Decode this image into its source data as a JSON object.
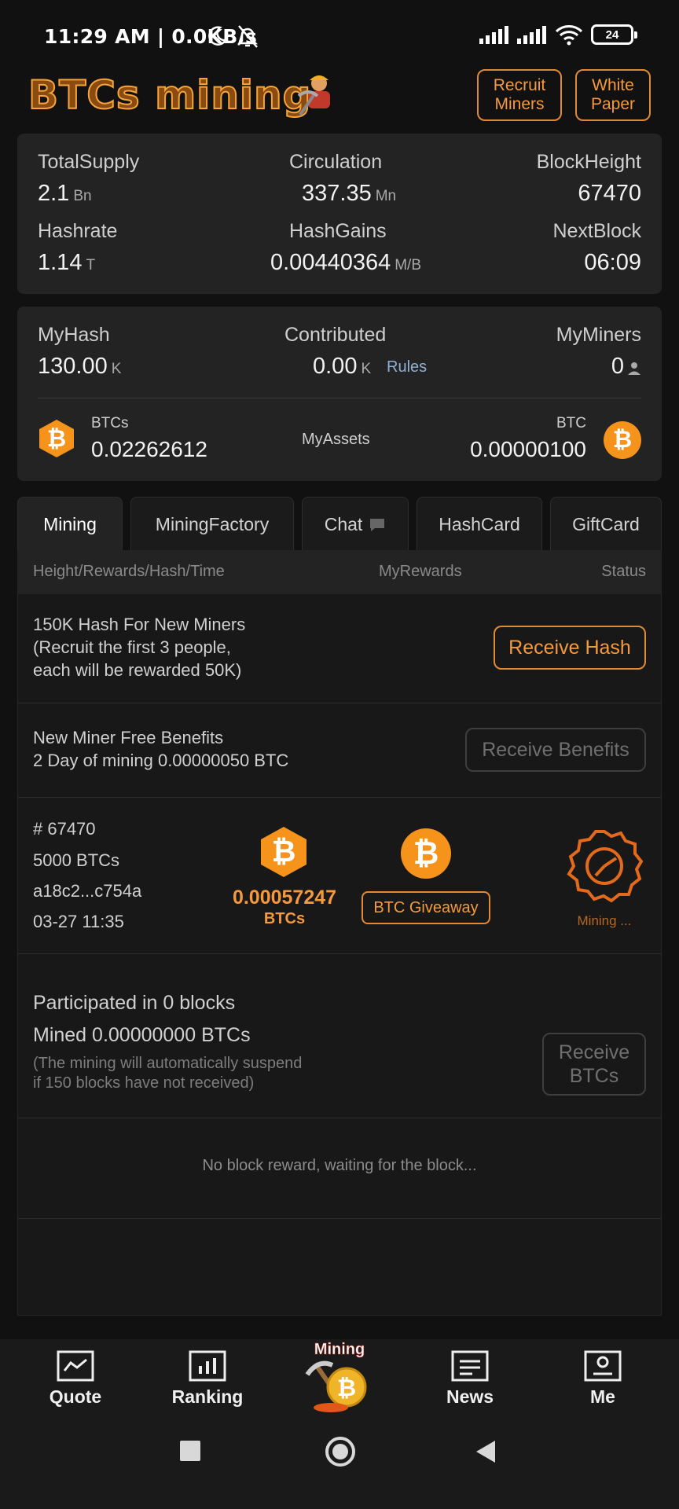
{
  "status_bar": {
    "time": "11:29 AM | 0.0KB/s",
    "battery": "24"
  },
  "header": {
    "logo": "BTCs mining",
    "recruit_btn": "Recruit\nMiners",
    "whitepaper_btn": "White\nPaper"
  },
  "stats": {
    "total_supply": {
      "label": "TotalSupply",
      "value": "2.1",
      "unit": "Bn"
    },
    "circulation": {
      "label": "Circulation",
      "value": "337.35",
      "unit": "Mn"
    },
    "block_height": {
      "label": "BlockHeight",
      "value": "67470"
    },
    "hashrate": {
      "label": "Hashrate",
      "value": "1.14",
      "unit": "T"
    },
    "hash_gains": {
      "label": "HashGains",
      "value": "0.00440364",
      "unit": "M/B"
    },
    "next_block": {
      "label": "NextBlock",
      "value": "06:09"
    }
  },
  "my": {
    "my_hash": {
      "label": "MyHash",
      "value": "130.00",
      "unit": "K"
    },
    "contributed": {
      "label": "Contributed",
      "value": "0.00",
      "unit": "K",
      "rules": "Rules"
    },
    "my_miners": {
      "label": "MyMiners",
      "value": "0"
    },
    "btcs": {
      "label": "BTCs",
      "value": "0.02262612"
    },
    "assets_label": "MyAssets",
    "btc": {
      "label": "BTC",
      "value": "0.00000100"
    }
  },
  "tabs": [
    "Mining",
    "MiningFactory",
    "Chat",
    "HashCard",
    "GiftCard"
  ],
  "table_headers": {
    "col1": "Height/Rewards/Hash/Time",
    "col2": "MyRewards",
    "col3": "Status"
  },
  "rows": {
    "new_miners": {
      "text": "150K Hash For New Miners\n(Recruit the first 3 people,\neach will be rewarded 50K)",
      "button": "Receive Hash"
    },
    "free_benefits": {
      "text": "New Miner Free Benefits\n2 Day of mining 0.00000050 BTC",
      "button": "Receive Benefits"
    },
    "block": {
      "height": "# 67470",
      "reward": "5000 BTCs",
      "hash": "a18c2...c754a",
      "time": "03-27 11:35",
      "my_reward": "0.00057247",
      "my_reward_unit": "BTCs",
      "giveaway": "BTC Giveaway",
      "status": "Mining ..."
    },
    "participated": {
      "line1": "Participated in 0 blocks",
      "line2": "Mined 0.00000000 BTCs",
      "note": "(The mining will automatically suspend\nif 150 blocks have not received)",
      "button": "Receive\nBTCs"
    },
    "empty_msg": "No block reward, waiting for the block..."
  },
  "nav": {
    "quote": "Quote",
    "ranking": "Ranking",
    "mining": "Mining",
    "news": "News",
    "me": "Me"
  },
  "colors": {
    "accent": "#f59a3c",
    "bitcoin": "#f5931a",
    "background": "#111111",
    "card": "#232323"
  }
}
